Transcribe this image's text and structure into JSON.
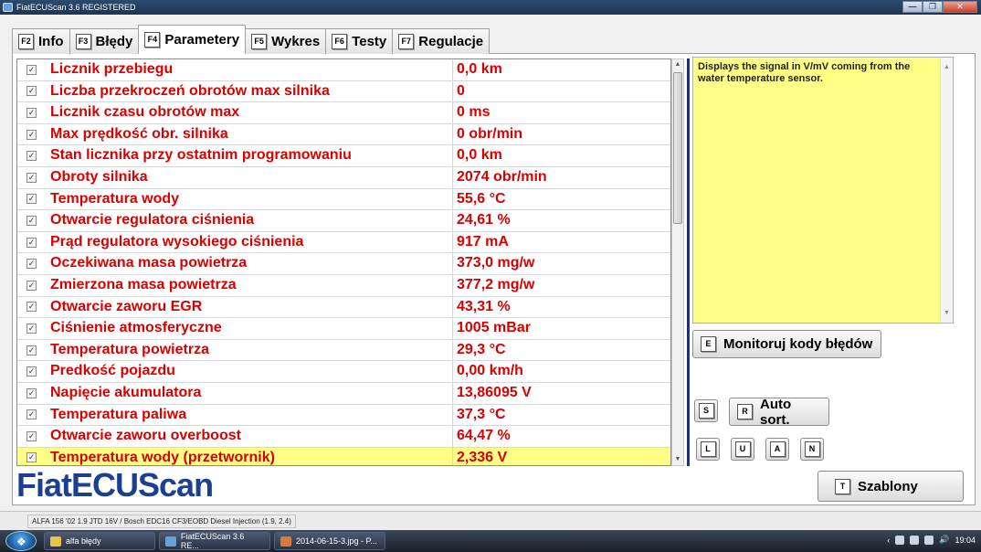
{
  "window": {
    "title": "FiatECUScan 3.6 REGISTERED",
    "controls": [
      "—",
      "❐",
      "✕"
    ]
  },
  "tabs": [
    {
      "key": "F2",
      "label": "Info"
    },
    {
      "key": "F3",
      "label": "Błędy"
    },
    {
      "key": "F4",
      "label": "Parametery"
    },
    {
      "key": "F5",
      "label": "Wykres"
    },
    {
      "key": "F6",
      "label": "Testy"
    },
    {
      "key": "F7",
      "label": "Regulacje"
    }
  ],
  "parameters": [
    {
      "name": "Licznik przebiegu",
      "value": "0,0 km",
      "checked": true
    },
    {
      "name": "Liczba przekroczeń obrotów max silnika",
      "value": "0",
      "checked": true
    },
    {
      "name": "Licznik czasu obrotów max",
      "value": "0 ms",
      "checked": true
    },
    {
      "name": "Max prędkość obr. silnika",
      "value": "0 obr/min",
      "checked": true
    },
    {
      "name": "Stan licznika przy ostatnim programowaniu",
      "value": "0,0 km",
      "checked": true
    },
    {
      "name": "Obroty silnika",
      "value": "2074 obr/min",
      "checked": true
    },
    {
      "name": "Temperatura wody",
      "value": "55,6 °C",
      "checked": true
    },
    {
      "name": "Otwarcie regulatora ciśnienia",
      "value": "24,61 %",
      "checked": true
    },
    {
      "name": "Prąd regulatora wysokiego ciśnienia",
      "value": "917 mA",
      "checked": true
    },
    {
      "name": "Oczekiwana masa powietrza",
      "value": "373,0 mg/w",
      "checked": true
    },
    {
      "name": "Zmierzona masa powietrza",
      "value": "377,2 mg/w",
      "checked": true
    },
    {
      "name": "Otwarcie zaworu EGR",
      "value": "43,31 %",
      "checked": true
    },
    {
      "name": "Ciśnienie atmosferyczne",
      "value": "1005 mBar",
      "checked": true
    },
    {
      "name": "Temperatura powietrza",
      "value": "29,3 °C",
      "checked": true
    },
    {
      "name": "Predkość pojazdu",
      "value": "0,00 km/h",
      "checked": true
    },
    {
      "name": "Napięcie akumulatora",
      "value": "13,86095 V",
      "checked": true
    },
    {
      "name": "Temperatura paliwa",
      "value": "37,3 °C",
      "checked": true
    },
    {
      "name": "Otwarcie zaworu overboost",
      "value": "64,47 %",
      "checked": true
    },
    {
      "name": "Temperatura wody (przetwornik)",
      "value": "2,336 V",
      "checked": true,
      "selected": true
    }
  ],
  "description": "Displays the signal in V/mV coming from the water temperature sensor.",
  "buttons": {
    "monitor": {
      "key": "E",
      "label": "Monitoruj kody błędów"
    },
    "s_key": "S",
    "autosort": {
      "key": "R",
      "label": "Auto sort."
    },
    "l_key": "L",
    "u_key": "U",
    "a_key": "A",
    "n_key": "N",
    "templates": {
      "key": "T",
      "label": "Szablony"
    }
  },
  "logo": "FiatECUScan",
  "status": "ALFA 156 '02 1.9 JTD 16V / Bosch EDC16 CF3/EOBD Diesel Injection (1.9, 2.4)",
  "taskbar": {
    "tasks": [
      "alfa błędy",
      "FiatECUScan 3.6 RE...",
      "2014-06-15-3.jpg - P..."
    ],
    "clock": "19:04"
  }
}
